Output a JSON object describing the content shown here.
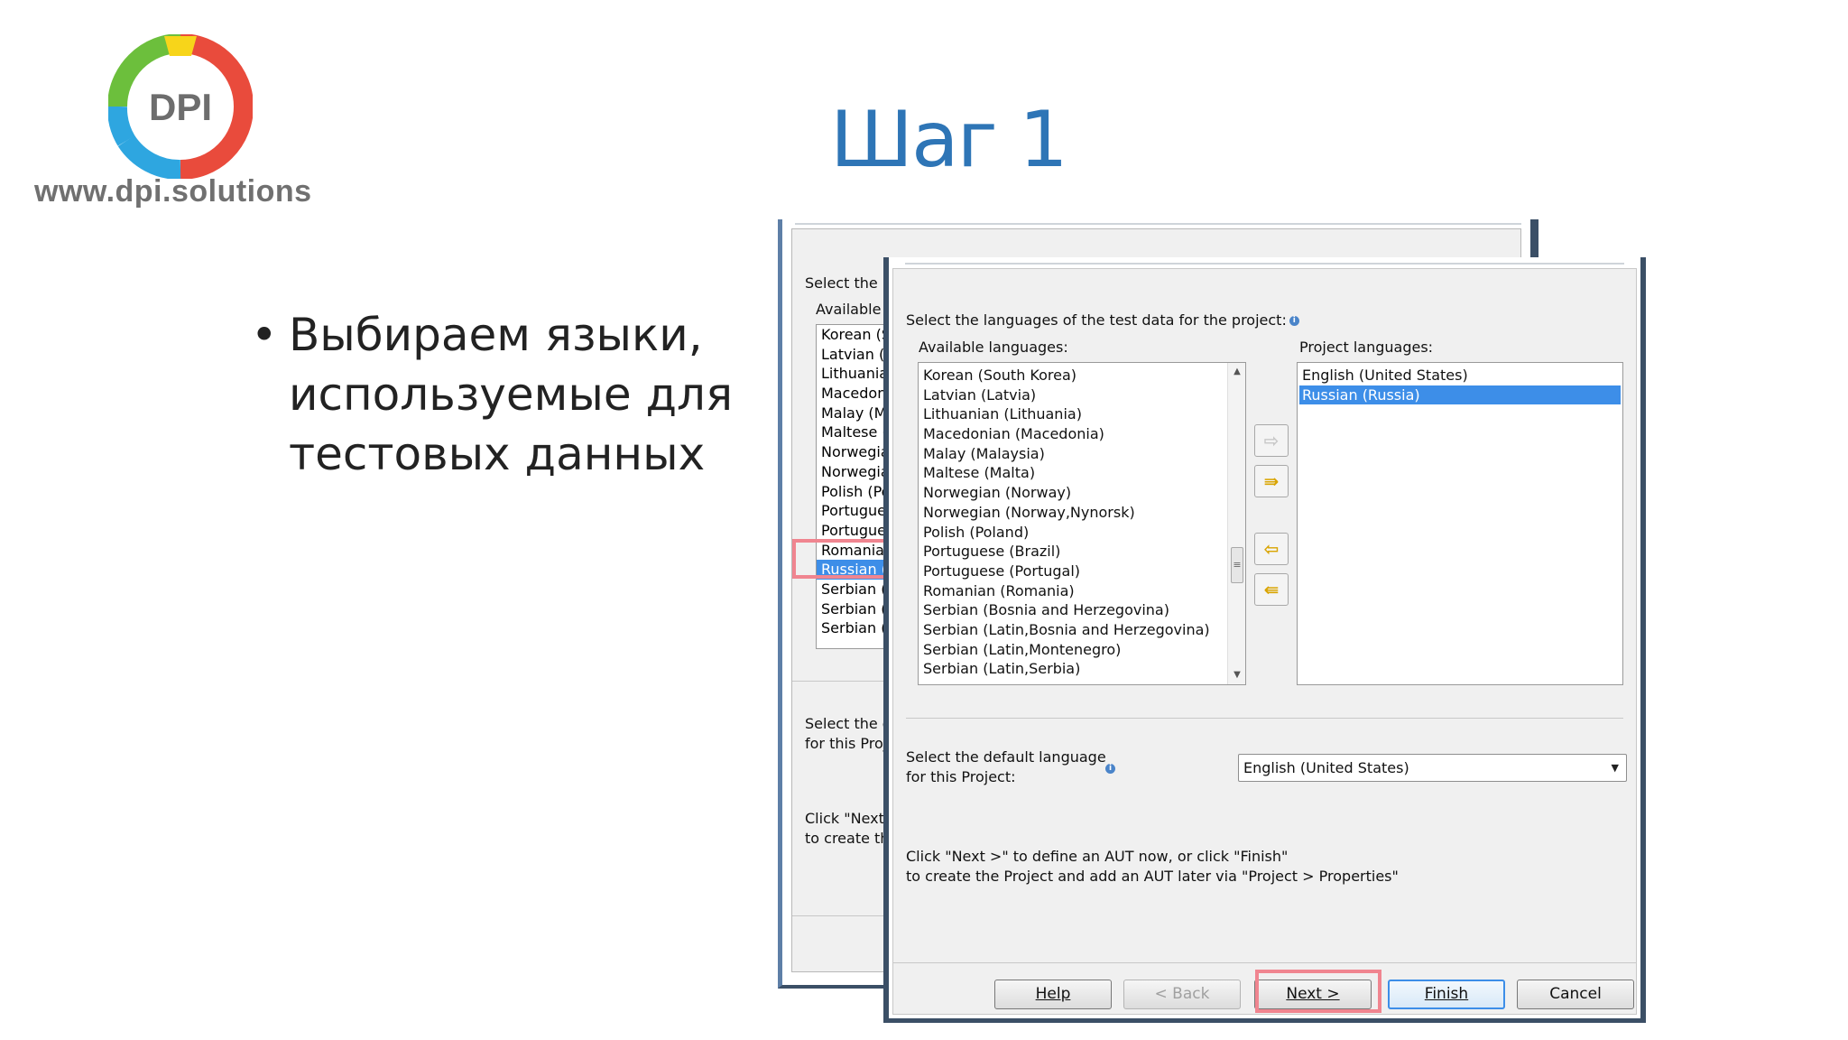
{
  "slide": {
    "logo_text": "DPI",
    "logo_url": "www.dpi.solutions",
    "title": "Шаг 1",
    "bullet": "Выбираем языки, используемые для тестовых данных"
  },
  "back_dialog": {
    "label_select": "Select the lan",
    "label_available": "Available lan",
    "items": [
      "Korean (So",
      "Latvian (Lat",
      "Lithuanian",
      "Macedonia",
      "Malay (Mal",
      "Maltese (M",
      "Norwegian",
      "Norwegian",
      "Polish (Pola",
      "Portuguese",
      "Portuguese",
      "Romanian",
      "Russian (Ru",
      "Serbian (Bo",
      "Serbian (La",
      "Serbian (La"
    ],
    "selected_index": 12,
    "label_default": "Select the def for this Projec",
    "label_click": "Click \"Next >\" to create the I"
  },
  "dialog": {
    "label_select": "Select the languages of the test data for the project:",
    "label_available": "Available languages:",
    "label_project": "Project languages:",
    "available_languages": [
      "Korean (South Korea)",
      "Latvian (Latvia)",
      "Lithuanian (Lithuania)",
      "Macedonian (Macedonia)",
      "Malay (Malaysia)",
      "Maltese (Malta)",
      "Norwegian (Norway)",
      "Norwegian (Norway,Nynorsk)",
      "Polish (Poland)",
      "Portuguese (Brazil)",
      "Portuguese (Portugal)",
      "Romanian (Romania)",
      "Serbian (Bosnia and Herzegovina)",
      "Serbian (Latin,Bosnia and Herzegovina)",
      "Serbian (Latin,Montenegro)",
      "Serbian (Latin,Serbia)"
    ],
    "project_languages": [
      "English (United States)",
      "Russian (Russia)"
    ],
    "project_selected_index": 1,
    "label_default_line1": "Select the default language",
    "label_default_line2": "for this Project:",
    "default_language": "English (United States)",
    "click_line1": "Click \"Next >\" to define an AUT now, or click \"Finish\"",
    "click_line2": "to create the Project and add an AUT later via \"Project > Properties\"",
    "buttons": {
      "help": "Help",
      "back": "< Back",
      "next": "Next >",
      "finish": "Finish",
      "cancel": "Cancel"
    }
  },
  "colors": {
    "title": "#2e75b6",
    "selection": "#3d8ee8",
    "highlight_box": "#f08590",
    "arrow_active": "#d9a400"
  }
}
